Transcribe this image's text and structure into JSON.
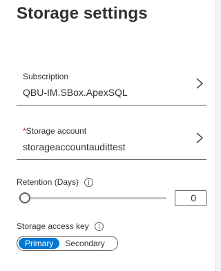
{
  "page": {
    "title": "Storage settings"
  },
  "subscription": {
    "label": "Subscription",
    "value": "QBU-IM.SBox.ApexSQL"
  },
  "storage_account": {
    "required_mark": "*",
    "label": "Storage account",
    "value": "storageaccountaudittest"
  },
  "retention": {
    "label": "Retention (Days)",
    "value": "0",
    "slider_fraction": 0
  },
  "access_key": {
    "label": "Storage access key",
    "options": [
      "Primary",
      "Secondary"
    ],
    "selected": "Primary"
  },
  "colors": {
    "accent": "#0078d4",
    "required": "#a4262c",
    "text": "#323130"
  },
  "icons": {
    "picker": "chevron-right-icon",
    "info": "info-icon"
  }
}
